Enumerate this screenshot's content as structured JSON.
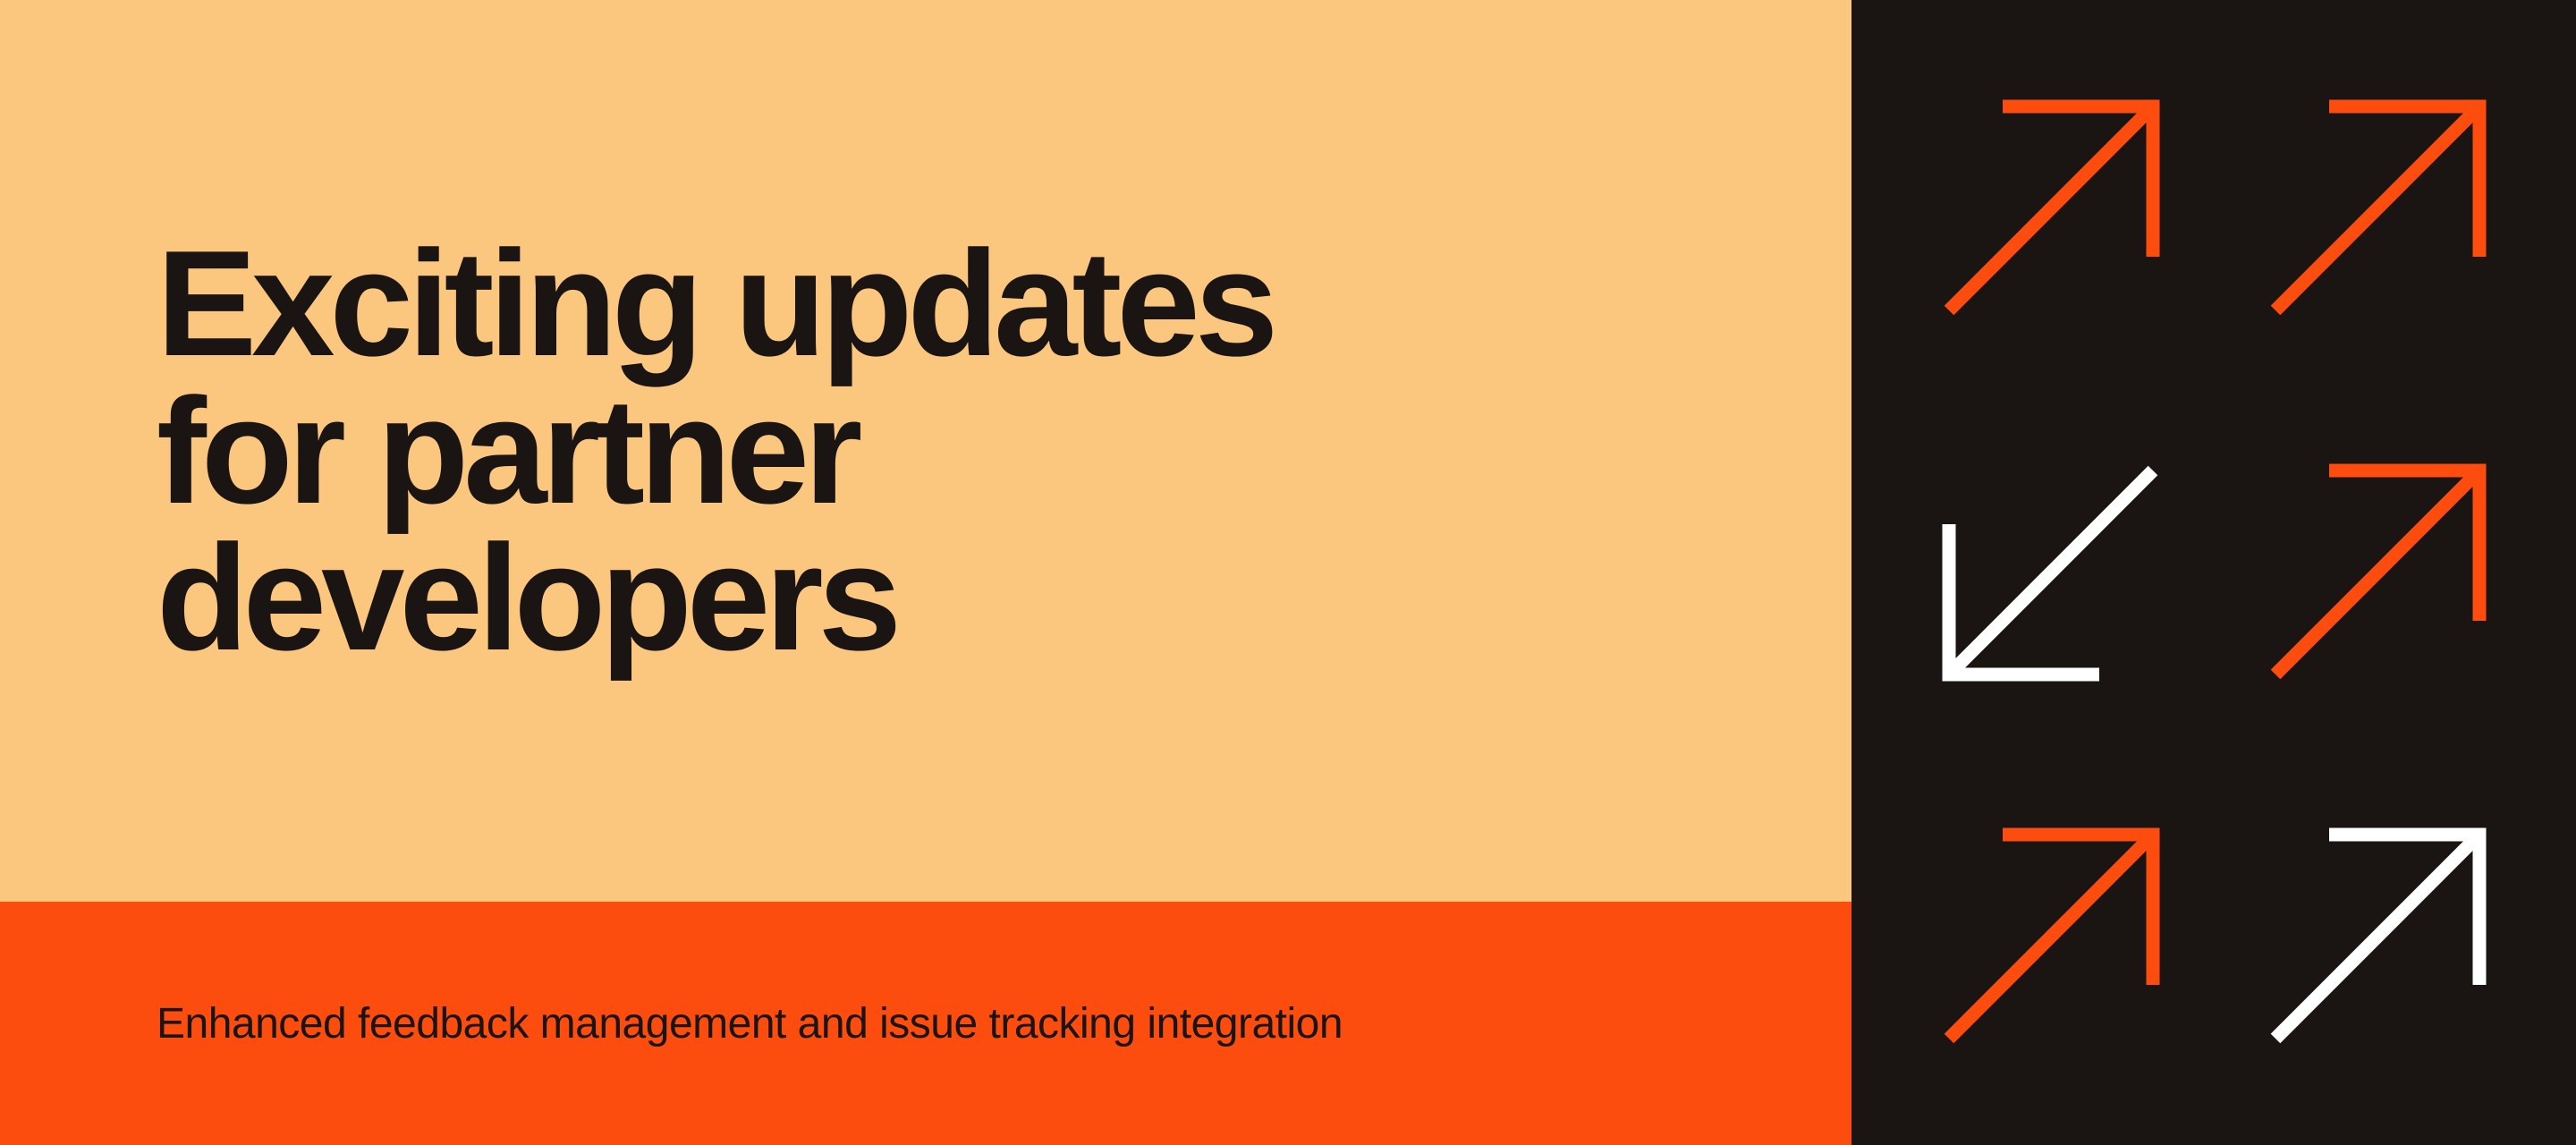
{
  "headline": {
    "line1": "Exciting updates",
    "line2": "for partner",
    "line3": "developers"
  },
  "subhead": "Enhanced feedback management and issue tracking integration",
  "colors": {
    "bgTop": "#fbc77f",
    "bgBottom": "#fc4d0e",
    "bgRight": "#1a1513",
    "arrowOrange": "#fc4d0e",
    "arrowWhite": "#ffffff"
  },
  "arrows": [
    {
      "color": "#fc4d0e",
      "dir": "up-right"
    },
    {
      "color": "#fc4d0e",
      "dir": "up-right"
    },
    {
      "color": "#ffffff",
      "dir": "down-left"
    },
    {
      "color": "#fc4d0e",
      "dir": "up-right"
    },
    {
      "color": "#fc4d0e",
      "dir": "up-right"
    },
    {
      "color": "#ffffff",
      "dir": "up-right"
    }
  ]
}
